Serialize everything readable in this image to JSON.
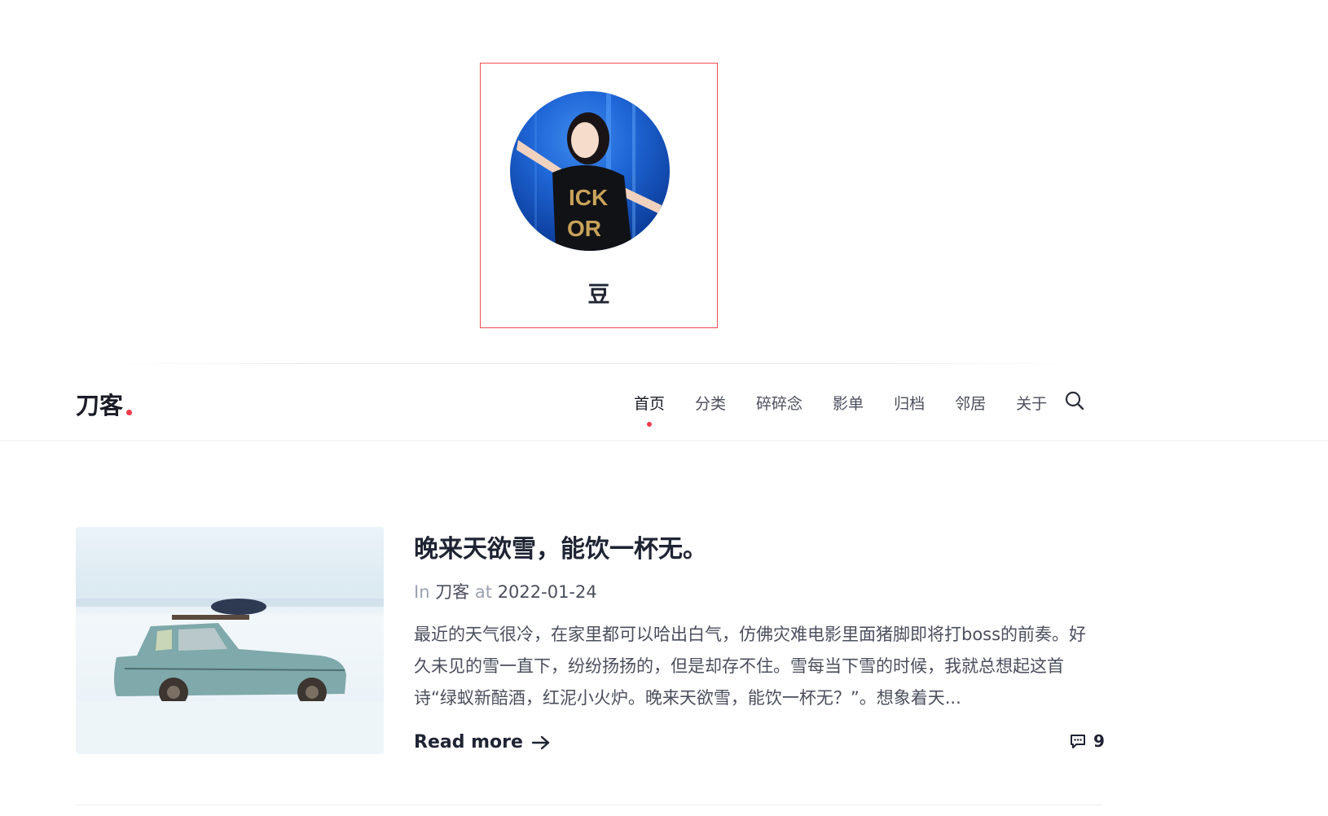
{
  "profile": {
    "name": "豆",
    "highlight_color": "#f24b55"
  },
  "header": {
    "logo": "刀客",
    "accent_color": "#f23b4c",
    "nav": [
      {
        "label": "首页",
        "active": true
      },
      {
        "label": "分类"
      },
      {
        "label": "碎碎念"
      },
      {
        "label": "影单"
      },
      {
        "label": "归档"
      },
      {
        "label": "邻居"
      },
      {
        "label": "关于"
      }
    ],
    "search_icon": "search-icon"
  },
  "post": {
    "title": "晚来天欲雪，能饮一杯无。",
    "meta_in": "In",
    "category": "刀客",
    "meta_at": "at",
    "date": "2022-01-24",
    "excerpt": "最近的天气很冷，在家里都可以哈出白气，仿佛灾难电影里面猪脚即将打boss的前奏。好久未见的雪一直下，纷纷扬扬的，但是却存不住。雪每当下雪的时候，我就总想起这首诗“绿蚁新醅酒，红泥小火炉。晚来天欲雪，能饮一杯无？”。想象着天...",
    "read_more": "Read more",
    "comment_count": "9"
  }
}
